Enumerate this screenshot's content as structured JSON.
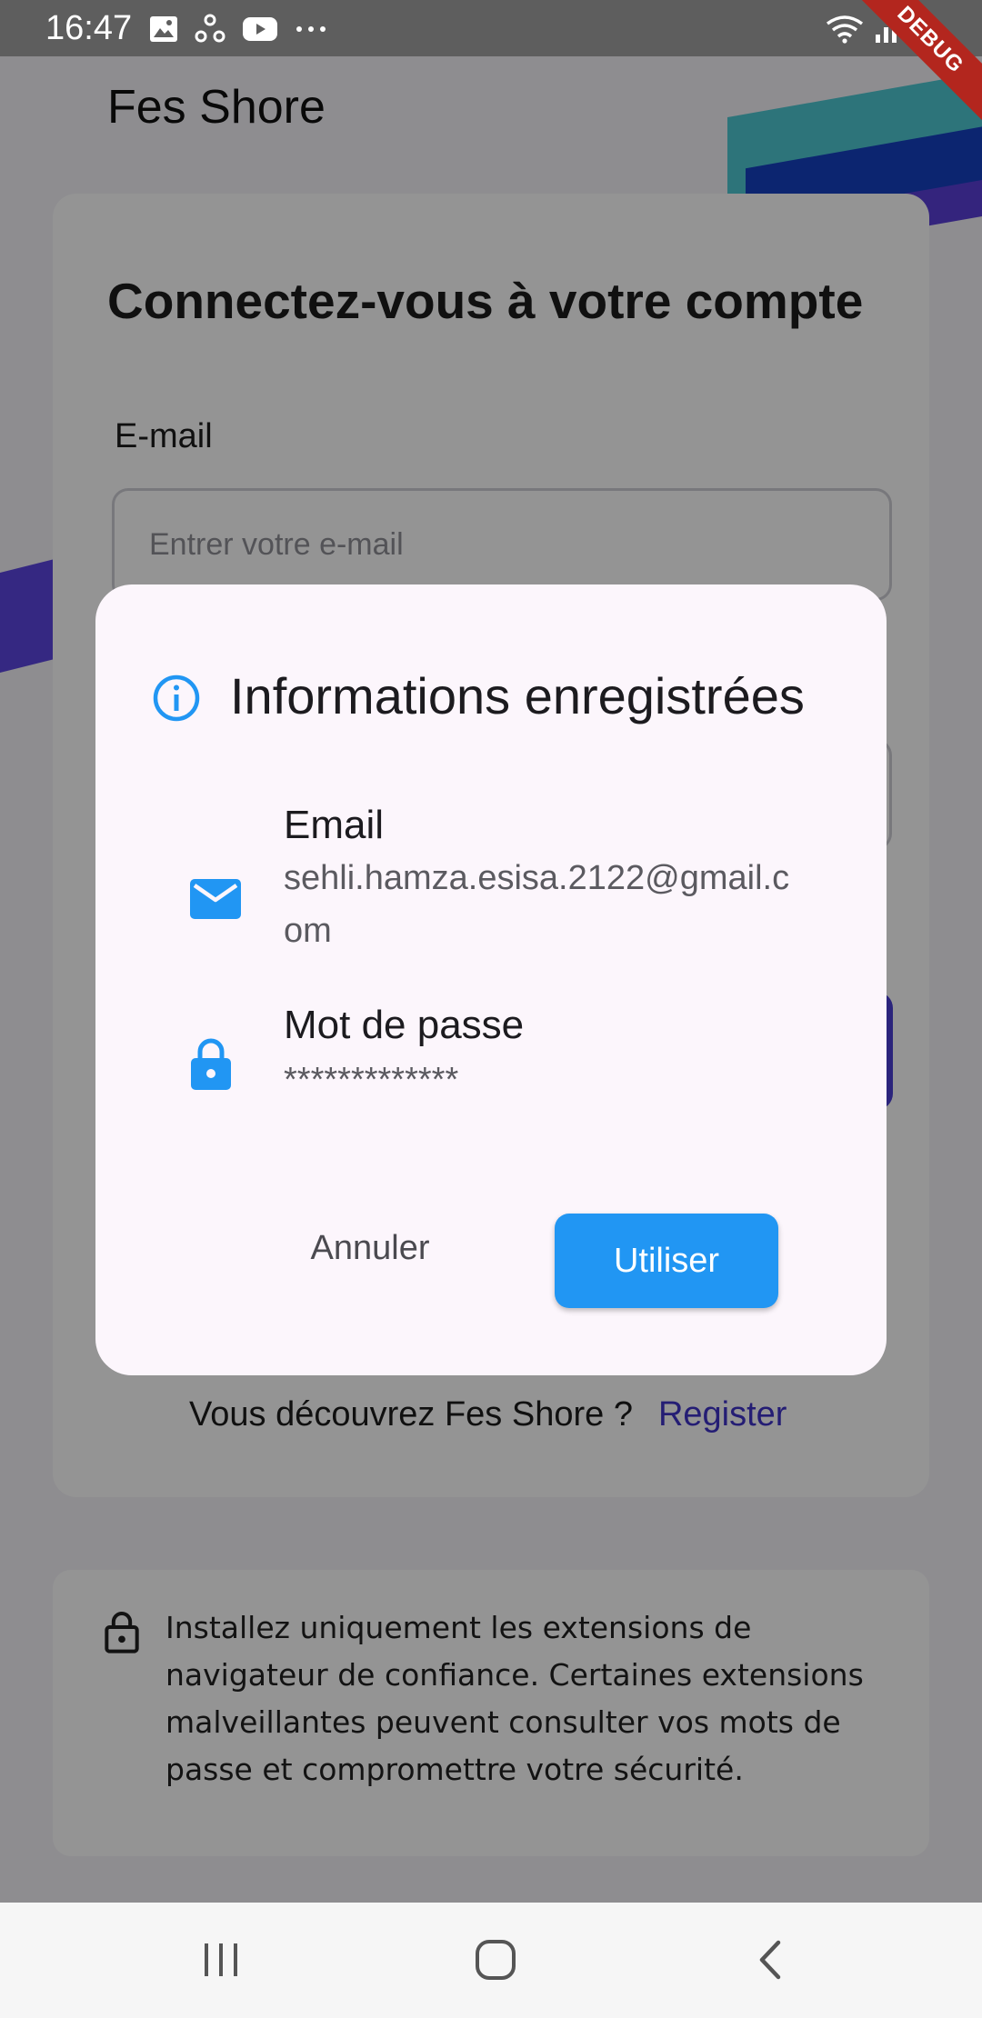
{
  "status_bar": {
    "time": "16:47",
    "left_icons": [
      "gallery-icon",
      "sync-icon",
      "youtube-icon",
      "more-dots-icon"
    ],
    "right_icons": [
      "wifi-icon",
      "signal-icon",
      "battery-icon"
    ],
    "debug_label": "DEBUG"
  },
  "app": {
    "title": "Fes Shore",
    "login_heading": "Connectez-vous à votre compte",
    "email_label": "E-mail",
    "email_placeholder": "Entrer votre e-mail",
    "register_prompt": "Vous découvrez Fes Shore ?",
    "register_link": "Register"
  },
  "notice": {
    "icon": "lock-outline-icon",
    "text": "Installez uniquement les extensions de navigateur de confiance. Certaines extensions malveillantes peuvent consulter vos mots de passe et compromettre votre sécurité."
  },
  "dialog": {
    "title": "Informations enregistrées",
    "icon": "info-icon",
    "email_label": "Email",
    "email_value": "sehli.hamza.esisa.2122@gmail.com",
    "password_label": "Mot de passe",
    "password_value": "*************",
    "cancel_label": "Annuler",
    "use_label": "Utiliser"
  },
  "colors": {
    "accent": "#2196f3",
    "brand": "#3f33c9",
    "dialog_bg": "#fcf6fc"
  },
  "nav_bar": {
    "buttons": [
      "recents-icon",
      "home-icon",
      "back-icon"
    ]
  }
}
